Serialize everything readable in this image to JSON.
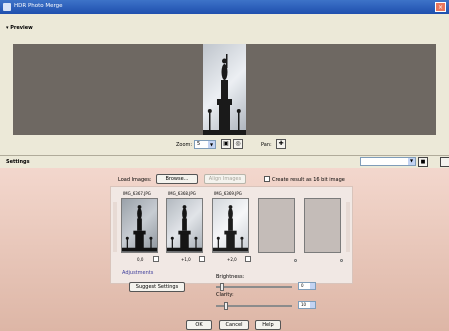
{
  "window": {
    "title": "HDR Photo Merge",
    "close_glyph": "×"
  },
  "preview": {
    "heading": "▾ Preview"
  },
  "zoom": {
    "label": "Zoom:",
    "value": "5",
    "pan_label": "Pan:"
  },
  "settings": {
    "heading": "Settings"
  },
  "load": {
    "label": "Load Images:",
    "browse": "Browse...",
    "align": "Align Images",
    "create_16bit": "Create result as 16 bit image"
  },
  "images": [
    {
      "name": "IMG_6367.JPG",
      "ev": "0,0"
    },
    {
      "name": "IMG_6368.JPG",
      "ev": "+1,0"
    },
    {
      "name": "IMG_6369.JPG",
      "ev": "+2,0"
    }
  ],
  "adjustments": {
    "heading": "Adjustments",
    "suggest": "Suggest Settings",
    "brightness_label": "Brightness:",
    "brightness_value": "0",
    "brightness_fraction": 0.05,
    "clarity_label": "Clarity:",
    "clarity_value": "10",
    "clarity_fraction": 0.1
  },
  "buttons": {
    "ok": "OK",
    "cancel": "Cancel",
    "help": "Help"
  }
}
